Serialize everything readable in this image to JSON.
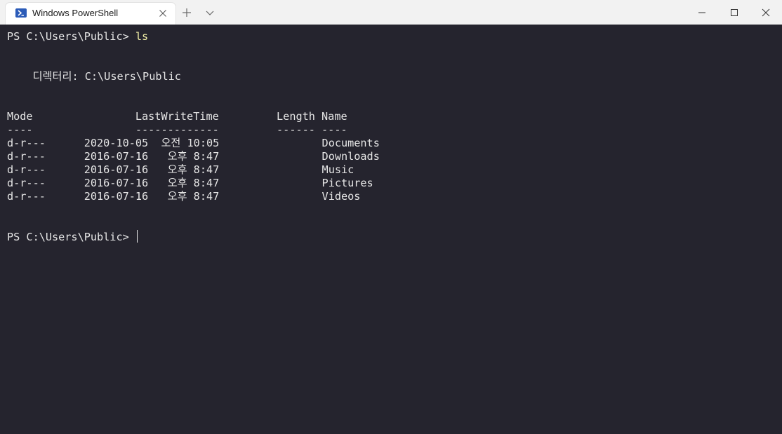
{
  "tab": {
    "title": "Windows PowerShell",
    "icon": "powershell-icon"
  },
  "window": {
    "icons": {
      "new_tab": "plus-icon",
      "dropdown": "chevron-down-icon",
      "minimize": "minimize-icon",
      "maximize": "maximize-icon",
      "close": "close-icon"
    }
  },
  "terminal": {
    "prompt1": "PS C:\\Users\\Public> ",
    "command1": "ls",
    "directory_line": "    디렉터리: C:\\Users\\Public",
    "header": "Mode                LastWriteTime         Length Name",
    "separator": "----                -------------         ------ ----",
    "rows": [
      "d-r---      2020-10-05  오전 10:05                Documents",
      "d-r---      2016-07-16   오후 8:47                Downloads",
      "d-r---      2016-07-16   오후 8:47                Music",
      "d-r---      2016-07-16   오후 8:47                Pictures",
      "d-r---      2016-07-16   오후 8:47                Videos"
    ],
    "prompt2": "PS C:\\Users\\Public> "
  },
  "colors": {
    "background": "#25242e",
    "foreground": "#e6e6e6",
    "command": "#f4f1a8",
    "titlebar": "#f2f2f2",
    "tab_icon": "#2b5bb8"
  }
}
